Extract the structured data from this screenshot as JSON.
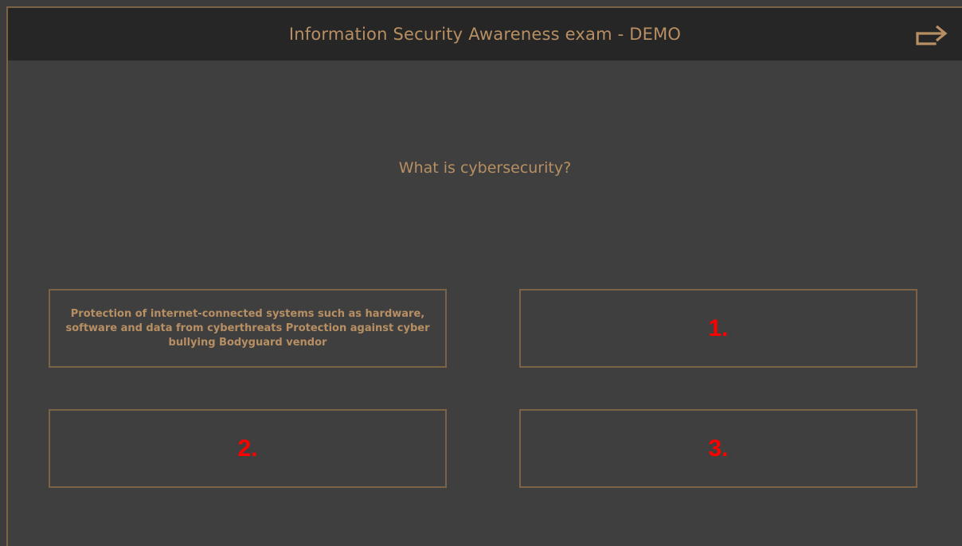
{
  "header": {
    "title": "Information Security Awareness exam - DEMO",
    "exit_icon": "exit-arrow-icon"
  },
  "question": {
    "text": "What is cybersecurity?"
  },
  "answers": [
    {
      "label": "Protection of internet-connected systems such as hardware, software and data from cyberthreats Protection against cyber bullying Bodyguard vendor"
    },
    {
      "label": "1."
    },
    {
      "label": "2."
    },
    {
      "label": "3."
    }
  ],
  "colors": {
    "accent": "#b78f63",
    "border": "#7a6347",
    "header_bg": "#262626",
    "body_bg": "#3f3f3f",
    "number_red": "#ff0000"
  }
}
